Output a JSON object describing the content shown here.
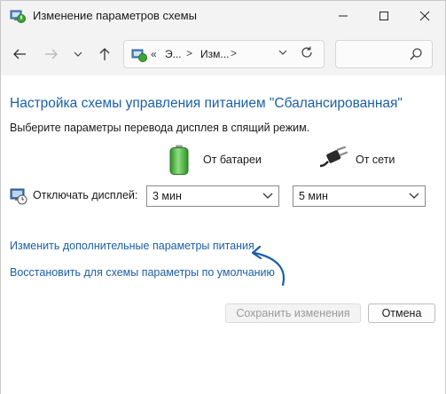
{
  "window": {
    "title": "Изменение параметров схемы",
    "controls": {
      "minimize": "—",
      "maximize": "☐",
      "close": "✕"
    }
  },
  "nav": {
    "back_icon": "arrow-left",
    "forward_icon": "arrow-right",
    "recent_icon": "chevron-down",
    "up_icon": "arrow-up"
  },
  "address": {
    "overflow": "«",
    "crumbs": [
      "Э...",
      "Изм..."
    ],
    "separator": ">",
    "dropdown": "⌄",
    "refresh": "↻"
  },
  "search": {
    "placeholder": ""
  },
  "main": {
    "heading": "Настройка схемы управления питанием \"Сбалансированная\"",
    "subheading": "Выберите параметры перевода дисплея в спящий режим.",
    "columns": {
      "battery": "От батареи",
      "ac": "От сети"
    },
    "display_setting": {
      "label": "Отключать дисплей:",
      "battery_value": "3 мин",
      "ac_value": "5 мин"
    },
    "links": {
      "advanced": "Изменить дополнительные параметры питания",
      "restore": "Восстановить для схемы параметры по умолчанию"
    }
  },
  "buttons": {
    "save": "Сохранить изменения",
    "cancel": "Отмена"
  },
  "colors": {
    "link": "#1a5fa8",
    "annotation_arrow": "#1a5fa8",
    "battery_green": "#3fa535"
  }
}
